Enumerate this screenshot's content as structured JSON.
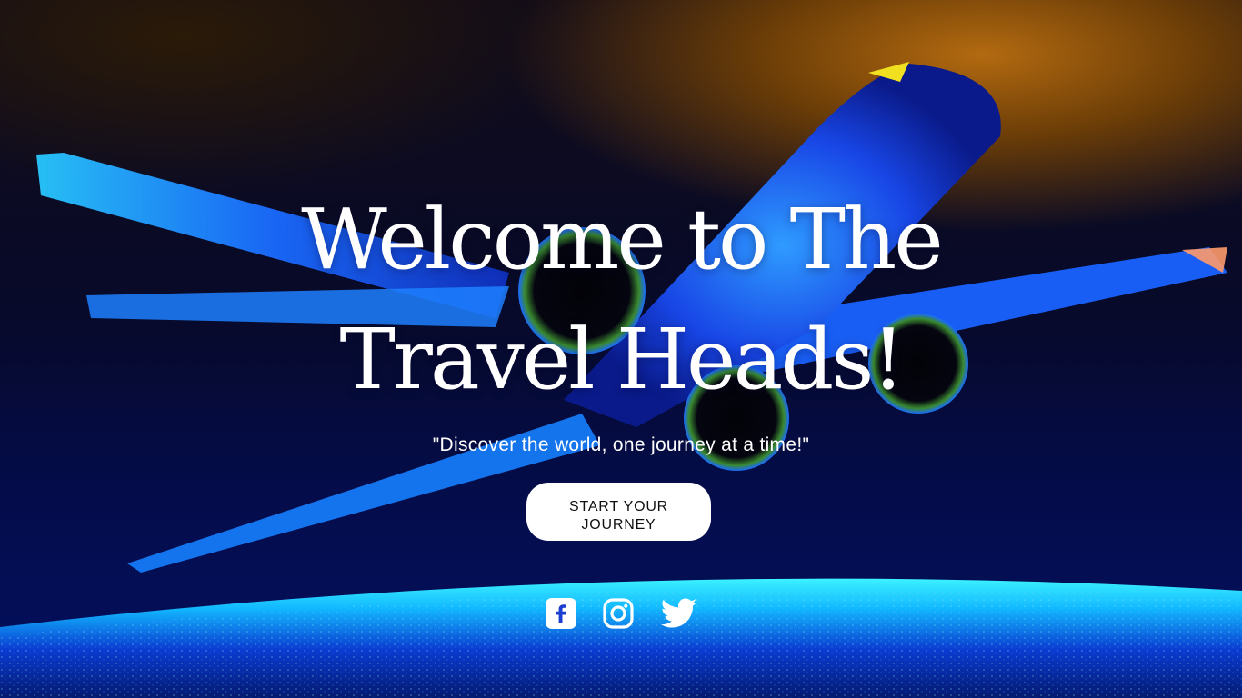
{
  "hero": {
    "headline_line1": "Welcome to The",
    "headline_line2": "Travel Heads!",
    "tagline": "\"Discover the world, one journey at a time!\"",
    "cta_label": "START YOUR JOURNEY",
    "background_image": "airplane-neon-blue-icon"
  },
  "social": [
    {
      "name": "facebook",
      "icon": "facebook-icon"
    },
    {
      "name": "instagram",
      "icon": "instagram-icon"
    },
    {
      "name": "twitter",
      "icon": "twitter-icon"
    }
  ],
  "colors": {
    "text": "#ffffff",
    "button_bg": "#ffffff",
    "button_text": "#111111",
    "glow_blue": "#1a6bff",
    "glow_cyan": "#19e6ff",
    "sky_orange": "#b36a10"
  }
}
